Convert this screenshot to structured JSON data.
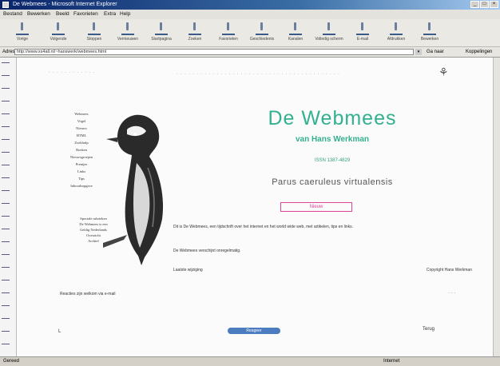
{
  "window": {
    "title": "De Webmees - Microsoft Internet Explorer"
  },
  "menu": [
    "Bestand",
    "Bewerken",
    "Beeld",
    "Favorieten",
    "Extra",
    "Help"
  ],
  "toolbar": [
    {
      "label": "Vorige",
      "icon": "back-icon"
    },
    {
      "label": "Volgende",
      "icon": "forward-icon"
    },
    {
      "label": "Stoppen",
      "icon": "stop-icon"
    },
    {
      "label": "Vernieuwen",
      "icon": "refresh-icon"
    },
    {
      "label": "Startpagina",
      "icon": "home-icon"
    },
    {
      "label": "Zoeken",
      "icon": "search-icon"
    },
    {
      "label": "Favorieten",
      "icon": "favorites-icon"
    },
    {
      "label": "Geschiedenis",
      "icon": "history-icon"
    },
    {
      "label": "Kanalen",
      "icon": "channels-icon"
    },
    {
      "label": "Volledig scherm",
      "icon": "fullscreen-icon"
    },
    {
      "label": "E-mail",
      "icon": "mail-icon"
    },
    {
      "label": "Afdrukken",
      "icon": "print-icon"
    },
    {
      "label": "Bewerken",
      "icon": "edit-icon"
    }
  ],
  "address": {
    "label": "Adres",
    "value": "http://www.xs4all.nl/~hanswerk/webmees.html",
    "go": "Ga naar",
    "links": "Koppelingen"
  },
  "page": {
    "site_title": "De Webmees",
    "site_subtitle": "van Hans Werkman",
    "small_line": "ISSN 1387-4829",
    "latin": "Parus caeruleus virtualensis",
    "badge": "Nieuw",
    "sidebar": [
      "Webmees",
      "Vogel",
      "Nieuws",
      "HTML",
      "Zoekhulp",
      "Boeken",
      "Nieuwsgroepen",
      "Prentjes",
      "Links",
      "Tips",
      "Inhoudsopgave"
    ],
    "caption": [
      "Speciale rubrieken",
      "De Webmees is een",
      "Geldig Nederlands",
      "Overzicht",
      "Archief"
    ],
    "para1": "Dit is De Webmees, een tijdschrift over het internet en het world wide web, met artikelen, tips en links.",
    "para2": "De Webmees verschijnt onregelmatig.",
    "para3": "Laatste wijziging",
    "para3r": "Copyright Hans Werkman",
    "bottom_note": "Reacties zijn welkom via e-mail",
    "bottom_button": "Reageer",
    "left_corner": "L",
    "right_corner": "Terug"
  },
  "status": {
    "text": "Gereed",
    "zone": "Internet"
  }
}
